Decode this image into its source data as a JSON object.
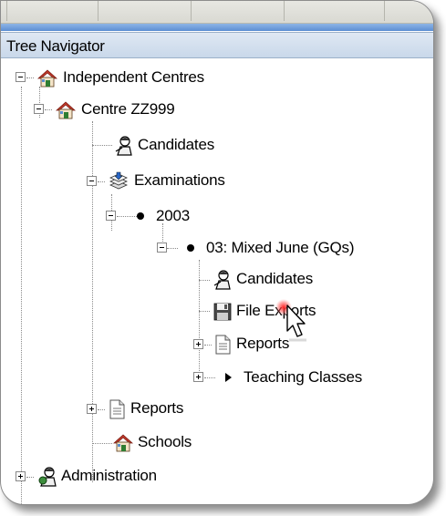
{
  "panel": {
    "title": "Tree Navigator"
  },
  "tree": {
    "root1": {
      "label": "Independent Centres",
      "icon": "house-icon"
    },
    "centre": {
      "label": "Centre ZZ999",
      "icon": "house-icon"
    },
    "candidates": {
      "label": "Candidates",
      "icon": "candidate-person-icon"
    },
    "examinations": {
      "label": "Examinations",
      "icon": "examinations-stack-icon"
    },
    "year": {
      "label": "2003",
      "icon": "bullet-icon"
    },
    "series": {
      "label": "03: Mixed June (GQs)",
      "icon": "bullet-icon"
    },
    "series_candidates": {
      "label": "Candidates",
      "icon": "candidate-person-icon"
    },
    "file_exports": {
      "label": "File Exports",
      "icon": "floppy-disk-icon"
    },
    "series_reports": {
      "label": "Reports",
      "icon": "document-icon"
    },
    "teaching_classes": {
      "label": "Teaching Classes",
      "icon": "triangle-arrow-icon"
    },
    "reports": {
      "label": "Reports",
      "icon": "document-icon"
    },
    "schools": {
      "label": "Schools",
      "icon": "house-icon"
    },
    "administration": {
      "label": "Administration",
      "icon": "admin-person-icon"
    }
  },
  "colors": {
    "header_blue": "#5c8fd3",
    "header_bg": "#dfe8f3",
    "house_roof": "#c0392b",
    "house_body": "#2e7d32",
    "click_marker": "#ff2020"
  }
}
